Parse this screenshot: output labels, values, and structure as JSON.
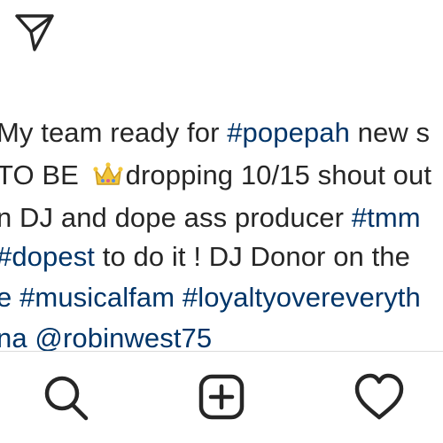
{
  "top_bar": {
    "share_icon": "paper-plane-icon"
  },
  "caption": {
    "lines": [
      {
        "segments": [
          {
            "text": "My team ready for "
          },
          {
            "text": "#popepah",
            "tag": true
          },
          {
            "text": " new s"
          }
        ]
      },
      {
        "segments": [
          {
            "text": "TO BE "
          },
          {
            "emoji": "crown"
          },
          {
            "text": "dropping 10/15 shout out"
          }
        ]
      },
      {
        "segments": [
          {
            "text": "n DJ and dope ass producer "
          },
          {
            "text": "#tmm",
            "tag": true
          }
        ]
      },
      {
        "segments": [
          {
            "text": "#dopest",
            "tag": true
          },
          {
            "text": " to do it ! DJ  Donor on the"
          }
        ]
      },
      {
        "segments": [
          {
            "text": "e ",
            "tag": true
          },
          {
            "text": "#musicalfam",
            "tag": true
          },
          {
            "text": " ",
            "tag": true
          },
          {
            "text": "#loyaltyovereveryth",
            "tag": true
          }
        ]
      },
      {
        "segments": [
          {
            "text": "na ",
            "tag": true
          },
          {
            "text": "@robinwest75",
            "tag": true
          }
        ]
      }
    ]
  },
  "bottom_nav": {
    "items": [
      {
        "name": "search-icon"
      },
      {
        "name": "new-post-icon"
      },
      {
        "name": "heart-icon"
      }
    ]
  },
  "colors": {
    "text": "#262626",
    "hashtag": "#003569",
    "divider": "#dbdbdb",
    "background": "#ffffff"
  }
}
